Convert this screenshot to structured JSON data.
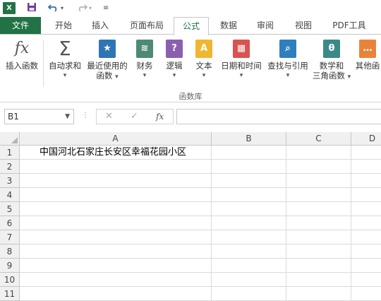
{
  "qat": {
    "app_icon": "X",
    "save_icon": "save-icon",
    "undo_icon": "undo-icon",
    "redo_icon": "redo-icon",
    "customize_icon": "customize-qat-icon"
  },
  "tabs": [
    "文件",
    "开始",
    "插入",
    "页面布局",
    "公式",
    "数据",
    "审阅",
    "视图",
    "PDF工具"
  ],
  "active_tab": "公式",
  "ribbon": {
    "group_label": "函数库",
    "buttons": [
      {
        "label": "插入函数",
        "icon": "fx-icon"
      },
      {
        "label": "自动求和",
        "icon": "sigma-icon"
      },
      {
        "label": "最近使用的",
        "label2": "函数",
        "icon": "star-icon"
      },
      {
        "label": "财务",
        "icon": "coins-icon"
      },
      {
        "label": "逻辑",
        "icon": "question-icon"
      },
      {
        "label": "文本",
        "icon": "text-a-icon"
      },
      {
        "label": "日期和时间",
        "icon": "calendar-icon"
      },
      {
        "label": "查找与引用",
        "icon": "magnifier-icon"
      },
      {
        "label": "数学和",
        "label2": "三角函数",
        "icon": "theta-icon"
      },
      {
        "label": "其他函",
        "icon": "more-icon"
      }
    ]
  },
  "formula_bar": {
    "name_box": "B1",
    "fx": "fx",
    "formula": ""
  },
  "sheet": {
    "columns": [
      "A",
      "B",
      "C",
      "D"
    ],
    "rows": [
      "1",
      "2",
      "3",
      "4",
      "5",
      "6",
      "7",
      "8",
      "9",
      "10",
      "11"
    ],
    "a1": "中国河北石家庄长安区幸福花园小区"
  },
  "colors": {
    "excel_green": "#217346",
    "star_blue": "#2e75b6",
    "coin_teal": "#4e8a73",
    "logic_purple": "#8b5fb0",
    "text_yellow": "#f0b630",
    "date_red": "#d9534f",
    "lookup_blue": "#2f7fbe",
    "math_teal": "#3b8a88",
    "more_orange": "#e8843a"
  }
}
